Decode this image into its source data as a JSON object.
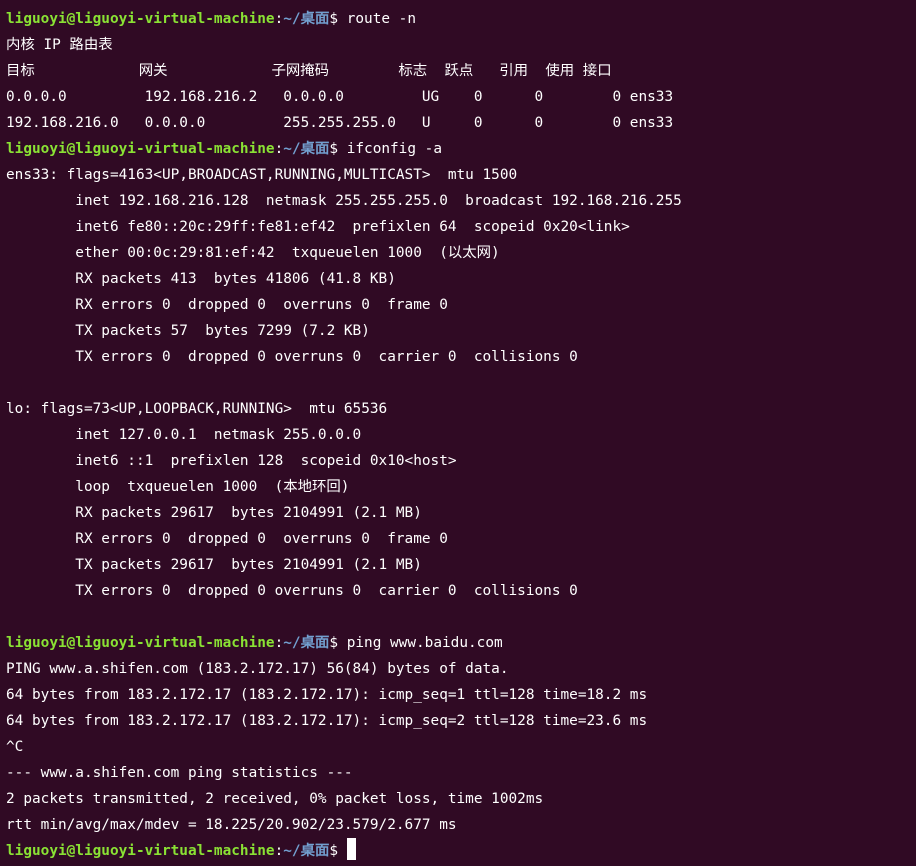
{
  "prompt": {
    "user": "liguoyi@liguoyi-virtual-machine",
    "colon": ":",
    "path": "~/桌面",
    "symbol": "$ "
  },
  "colors": {
    "background": "#300a24",
    "user": "#8ae234",
    "path": "#729fcf",
    "text": "#ffffff"
  },
  "commands": {
    "c1": "route -n",
    "c2": "ifconfig -a",
    "c3": "ping www.baidu.com"
  },
  "output": {
    "route": [
      "内核 IP 路由表",
      "目标            网关            子网掩码        标志  跃点   引用  使用 接口",
      "0.0.0.0         192.168.216.2   0.0.0.0         UG    0      0        0 ens33",
      "192.168.216.0   0.0.0.0         255.255.255.0   U     0      0        0 ens33"
    ],
    "ifconfig": [
      "ens33: flags=4163<UP,BROADCAST,RUNNING,MULTICAST>  mtu 1500",
      "        inet 192.168.216.128  netmask 255.255.255.0  broadcast 192.168.216.255",
      "        inet6 fe80::20c:29ff:fe81:ef42  prefixlen 64  scopeid 0x20<link>",
      "        ether 00:0c:29:81:ef:42  txqueuelen 1000  (以太网)",
      "        RX packets 413  bytes 41806 (41.8 KB)",
      "        RX errors 0  dropped 0  overruns 0  frame 0",
      "        TX packets 57  bytes 7299 (7.2 KB)",
      "        TX errors 0  dropped 0 overruns 0  carrier 0  collisions 0",
      "",
      "lo: flags=73<UP,LOOPBACK,RUNNING>  mtu 65536",
      "        inet 127.0.0.1  netmask 255.0.0.0",
      "        inet6 ::1  prefixlen 128  scopeid 0x10<host>",
      "        loop  txqueuelen 1000  (本地环回)",
      "        RX packets 29617  bytes 2104991 (2.1 MB)",
      "        RX errors 0  dropped 0  overruns 0  frame 0",
      "        TX packets 29617  bytes 2104991 (2.1 MB)",
      "        TX errors 0  dropped 0 overruns 0  carrier 0  collisions 0",
      ""
    ],
    "ping": [
      "PING www.a.shifen.com (183.2.172.17) 56(84) bytes of data.",
      "64 bytes from 183.2.172.17 (183.2.172.17): icmp_seq=1 ttl=128 time=18.2 ms",
      "64 bytes from 183.2.172.17 (183.2.172.17): icmp_seq=2 ttl=128 time=23.6 ms",
      "^C",
      "--- www.a.shifen.com ping statistics ---",
      "2 packets transmitted, 2 received, 0% packet loss, time 1002ms",
      "rtt min/avg/max/mdev = 18.225/20.902/23.579/2.677 ms"
    ]
  }
}
